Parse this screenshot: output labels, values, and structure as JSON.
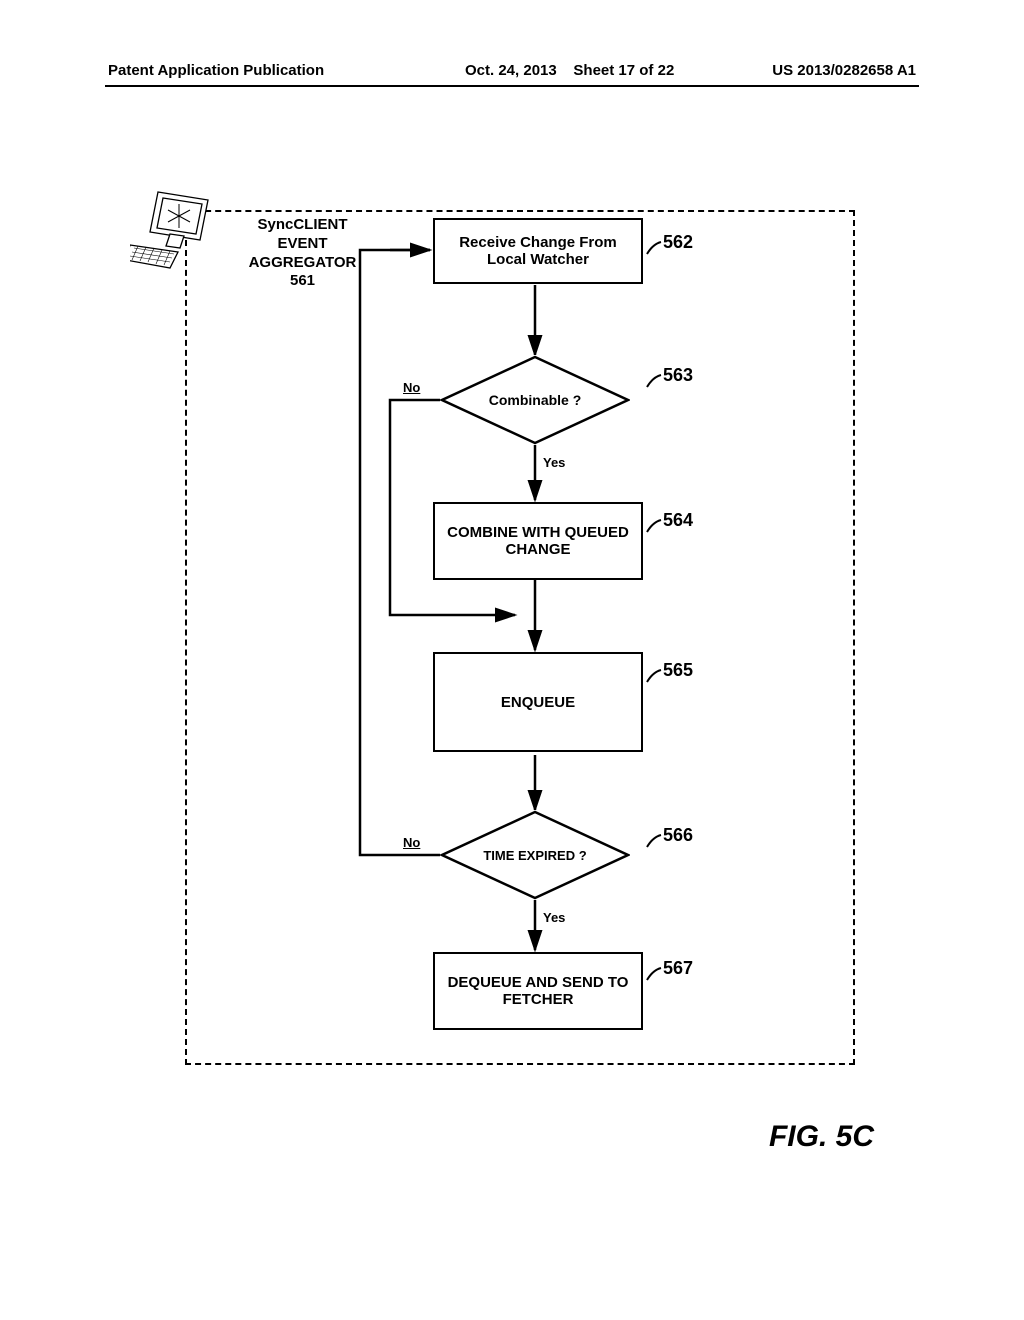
{
  "header": {
    "left": "Patent Application Publication",
    "mid_date": "Oct. 24, 2013",
    "mid_sheet": "Sheet 17 of 22",
    "right": "US 2013/0282658 A1"
  },
  "title": {
    "line1": "SyncCLIENT",
    "line2": "EVENT",
    "line3": "AGGREGATOR",
    "num": "561"
  },
  "boxes": {
    "b562": "Receive Change From Local Watcher",
    "b564": "COMBINE WITH QUEUED CHANGE",
    "b565": "ENQUEUE",
    "b567": "DEQUEUE AND SEND TO FETCHER"
  },
  "diamonds": {
    "d563": "Combinable ?",
    "d566": "TIME EXPIRED ?"
  },
  "labels": {
    "no": "No",
    "yes": "Yes"
  },
  "refs": {
    "r562": "562",
    "r563": "563",
    "r564": "564",
    "r565": "565",
    "r566": "566",
    "r567": "567"
  },
  "figure_caption": "FIG. 5C"
}
